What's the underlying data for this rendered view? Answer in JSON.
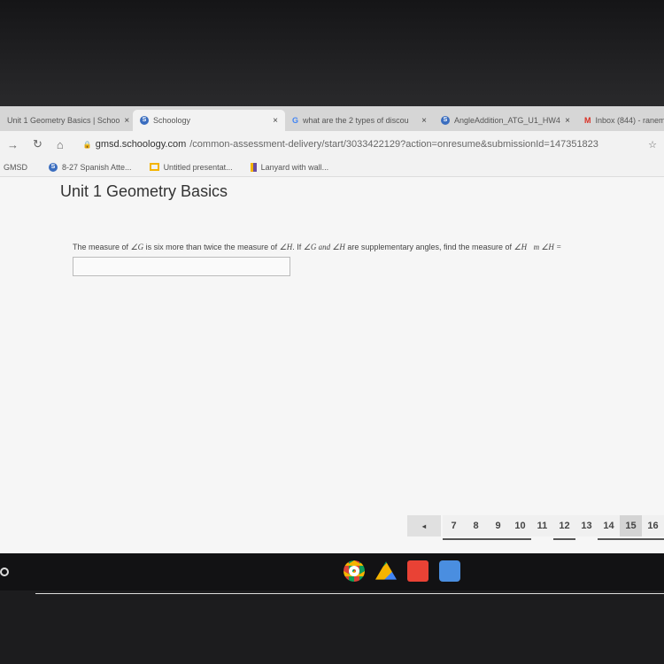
{
  "browser": {
    "tabs": [
      {
        "label": "Unit 1 Geometry Basics | Schoo",
        "close": "×"
      },
      {
        "label": "Schoology",
        "close": "×",
        "active": true
      },
      {
        "label": "what are the 2 types of discou",
        "close": "×"
      },
      {
        "label": "AngleAddition_ATG_U1_HW4",
        "close": "×"
      },
      {
        "label": "Inbox (844) - ranem"
      }
    ],
    "url_host": "gmsd.schoology.com",
    "url_path": "/common-assessment-delivery/start/3033422129?action=onresume&submissionId=147351823",
    "bookmarks": [
      "GMSD",
      "8-27 Spanish Atte...",
      "Untitled presentat...",
      "Lanyard with wall..."
    ]
  },
  "page": {
    "title": "Unit 1 Geometry Basics",
    "question": {
      "p1": "The measure of ",
      "g": "∠G",
      "p2": " is six more than twice the measure of ",
      "h": "∠H",
      "p3": ". If ",
      "gh": "∠G and ∠H",
      "p4": " are supplementary angles, find the measure of ",
      "h2": "∠H",
      ".": "",
      "mh": "m ∠H ="
    },
    "answer_value": ""
  },
  "pager": {
    "prev": "◂",
    "pages": [
      "7",
      "8",
      "9",
      "10",
      "11",
      "12",
      "13",
      "14",
      "15",
      "16"
    ],
    "answered": [
      "7",
      "8",
      "9",
      "10",
      "12",
      "14",
      "15",
      "16"
    ],
    "current": "15"
  },
  "colors": {
    "accent": "#3a6dbf"
  }
}
